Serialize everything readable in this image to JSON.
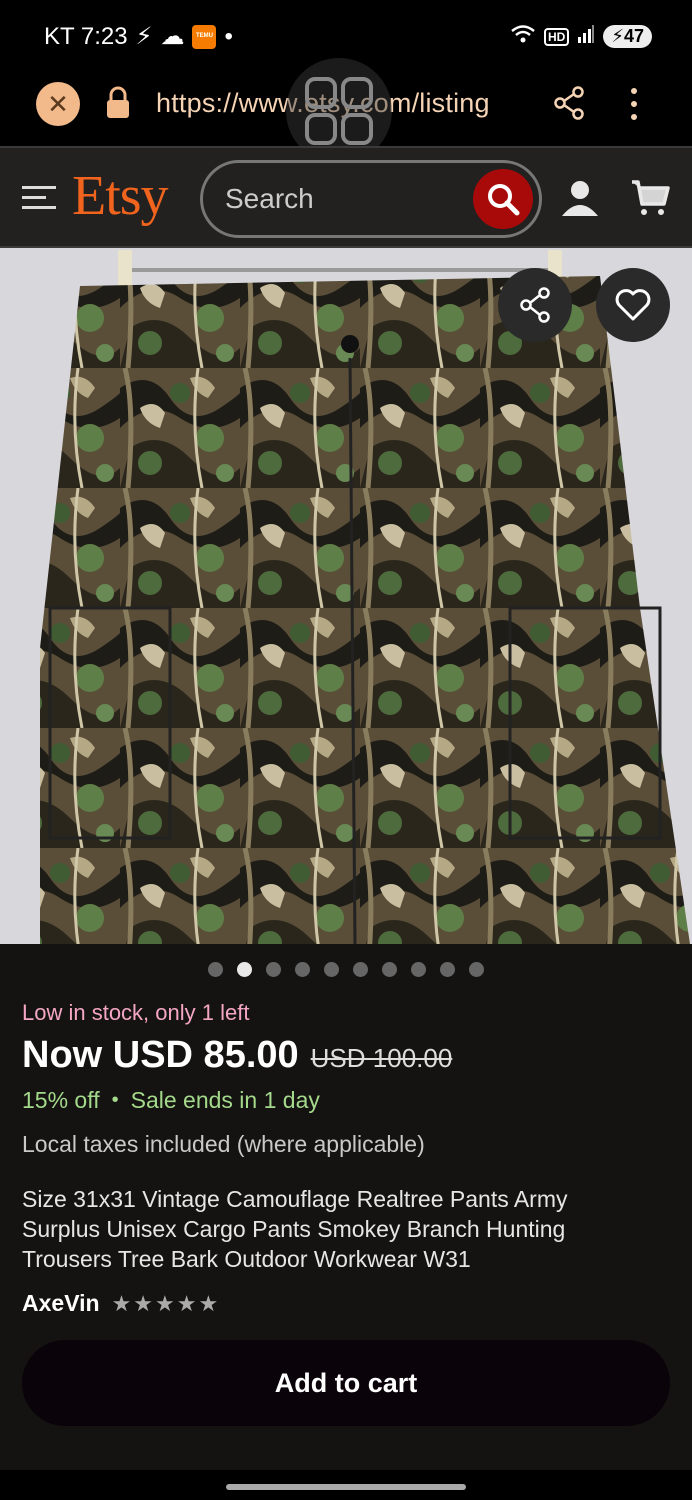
{
  "status_bar": {
    "carrier_time": "KT 7:23",
    "temu_label": "TEMU",
    "hd_label": "HD",
    "battery": "47"
  },
  "browser": {
    "url": "https://www.etsy.com/listing"
  },
  "header": {
    "logo": "Etsy",
    "search_placeholder": "Search"
  },
  "carousel": {
    "total_dots": 10,
    "active_index": 1
  },
  "listing": {
    "stock_note": "Low in stock, only 1 left",
    "price_now": "Now USD 85.00",
    "price_original": "USD 100.00",
    "discount": "15% off",
    "sale_note": "Sale ends in 1 day",
    "taxes_note": "Local taxes included (where applicable)",
    "title": "Size 31x31 Vintage Camouflage Realtree Pants Army Surplus Unisex Cargo Pants Smokey Branch Hunting Trousers Tree Bark Outdoor Workwear W31",
    "shop_name": "AxeVin",
    "rating_stars": 5,
    "add_to_cart": "Add to cart"
  },
  "colors": {
    "etsy_orange": "#f1641e",
    "stock_pink": "#f4a6c4",
    "discount_green": "#a4d98b",
    "search_red": "#a80a0a"
  }
}
